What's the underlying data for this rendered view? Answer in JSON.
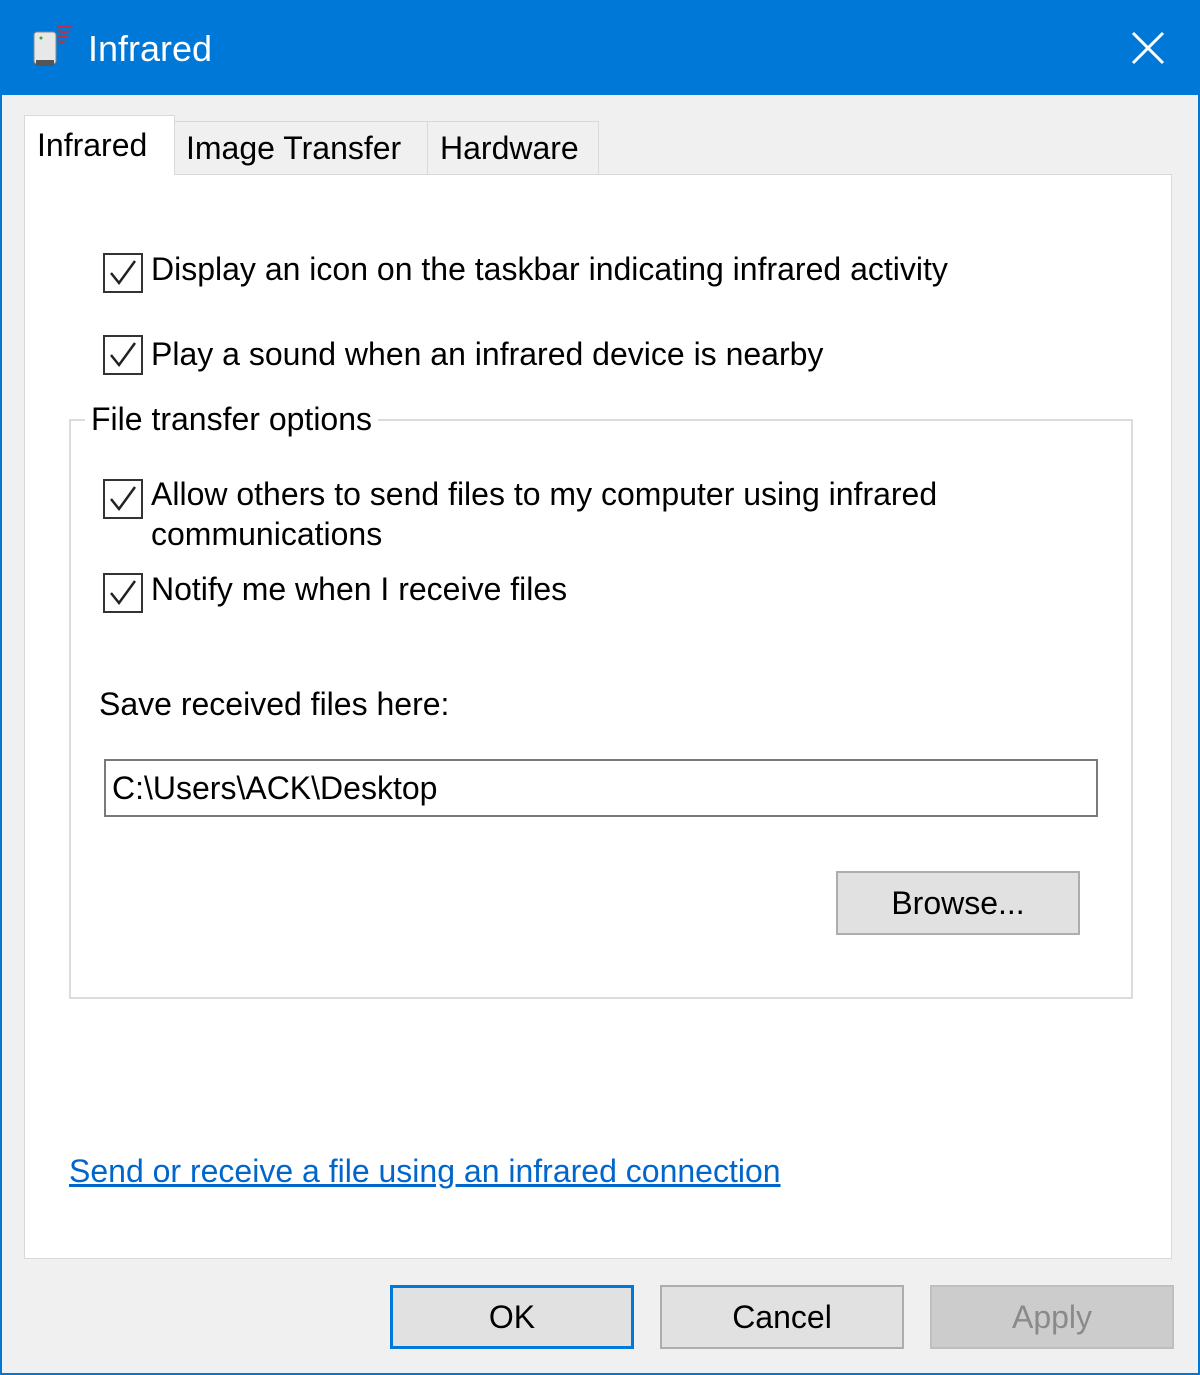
{
  "window": {
    "title": "Infrared",
    "accent": "#0078d7"
  },
  "tabs": [
    {
      "label": "Infrared",
      "selected": true
    },
    {
      "label": "Image Transfer",
      "selected": false
    },
    {
      "label": "Hardware",
      "selected": false
    }
  ],
  "options": [
    {
      "label": "Display an icon on the taskbar indicating infrared activity",
      "checked": true
    },
    {
      "label": "Play a sound when an infrared device is nearby",
      "checked": true
    }
  ],
  "file_transfer": {
    "group_label": "File transfer options",
    "options": [
      {
        "label_line1": "Allow others to send files to my computer using infrared",
        "label_line2": "communications",
        "checked": true
      },
      {
        "label": "Notify me when I receive files",
        "checked": true
      }
    ],
    "save_label": "Save received files here:",
    "save_path": "C:\\Users\\ACK\\Desktop",
    "browse_label": "Browse..."
  },
  "link_label": "Send or receive a file using an infrared connection",
  "buttons": {
    "ok": "OK",
    "cancel": "Cancel",
    "apply": "Apply"
  }
}
